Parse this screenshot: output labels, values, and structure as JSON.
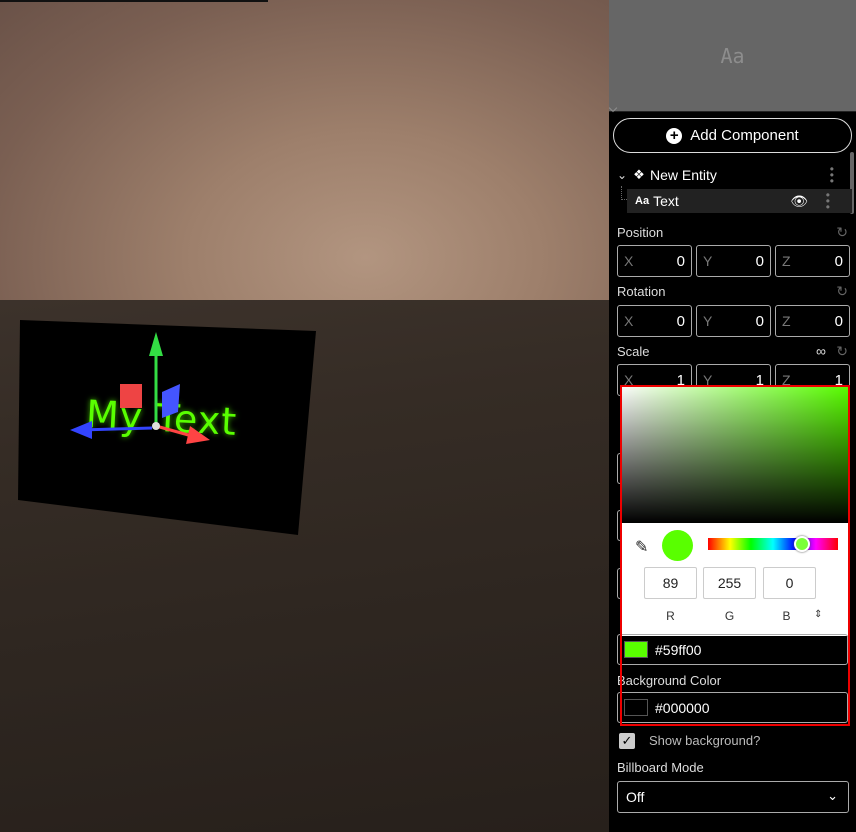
{
  "viewport": {
    "scene_text": "My Text"
  },
  "preview": {
    "glyph": "Aa"
  },
  "add_component": {
    "label": "Add Component"
  },
  "tree": {
    "entity": {
      "label": "New Entity",
      "icon": "entity-icon"
    },
    "component": {
      "label": "Text",
      "icon_text": "Aa"
    }
  },
  "position": {
    "label": "Position",
    "x": {
      "axis": "X",
      "value": "0"
    },
    "y": {
      "axis": "Y",
      "value": "0"
    },
    "z": {
      "axis": "Z",
      "value": "0"
    }
  },
  "rotation": {
    "label": "Rotation",
    "x": {
      "axis": "X",
      "value": "0"
    },
    "y": {
      "axis": "Y",
      "value": "0"
    },
    "z": {
      "axis": "Z",
      "value": "0"
    }
  },
  "scale": {
    "label": "Scale",
    "x": {
      "axis": "X",
      "value": "1"
    },
    "y": {
      "axis": "Y",
      "value": "1"
    },
    "z": {
      "axis": "Z",
      "value": "1"
    }
  },
  "picker": {
    "r": "89",
    "g": "255",
    "b": "0",
    "r_label": "R",
    "g_label": "G",
    "b_label": "B",
    "color": "#59ff00"
  },
  "text_color": {
    "value": "#59ff00",
    "swatch": "#59ff00"
  },
  "background_color": {
    "label": "Background Color",
    "value": "#000000",
    "swatch": "#000000"
  },
  "show_background": {
    "label": "Show background?",
    "checked": true
  },
  "billboard": {
    "label": "Billboard Mode",
    "value": "Off"
  }
}
